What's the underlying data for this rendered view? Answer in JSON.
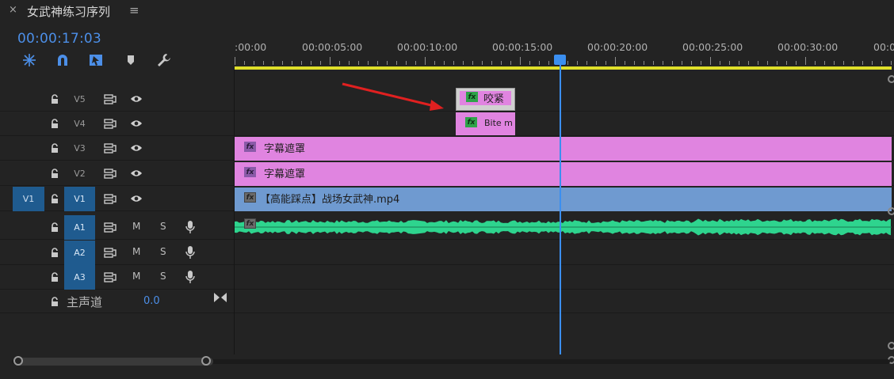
{
  "window": {
    "close_glyph": "×",
    "title": "女武神练习序列",
    "menu_glyph": "≡"
  },
  "header": {
    "timecode": "00:00:17:03",
    "tools": [
      "snap-in-nest-icon",
      "magnet-icon",
      "linked-selection-icon",
      "marker-icon",
      "wrench-icon"
    ]
  },
  "ruler": {
    "labels": [
      ":00:00",
      "00:00:05:00",
      "00:00:10:00",
      "00:00:15:00",
      "00:00:20:00",
      "00:00:25:00",
      "00:00:30:00",
      "00:0"
    ]
  },
  "tracks": {
    "video": [
      {
        "id": "V5",
        "label": "V5",
        "target_on": false
      },
      {
        "id": "V4",
        "label": "V4",
        "target_on": false
      },
      {
        "id": "V3",
        "label": "V3",
        "target_on": false
      },
      {
        "id": "V2",
        "label": "V2",
        "target_on": false
      },
      {
        "id": "V1",
        "label": "V1",
        "target_on": true,
        "source_patch": "V1"
      }
    ],
    "audio": [
      {
        "id": "A1",
        "label": "A1",
        "mute": "M",
        "solo": "S"
      },
      {
        "id": "A2",
        "label": "A2",
        "mute": "M",
        "solo": "S"
      },
      {
        "id": "A3",
        "label": "A3",
        "mute": "M",
        "solo": "S"
      }
    ],
    "master": {
      "label": "主声道",
      "value": "0.0"
    }
  },
  "clips": {
    "v5_title": "咬紧",
    "v4_title": "Bite m",
    "v3_title": "字幕遮罩",
    "v2_title": "字幕遮罩",
    "v1_title": "【高能踩点】战场女武神.mp4",
    "fx_label": "fx"
  },
  "colors": {
    "accent_blue": "#3b8ff0",
    "work_area": "#e0e02a",
    "graphic_clip": "#e084e0",
    "video_clip": "#6f9ad0",
    "audio_clip": "#1f7a5c",
    "waveform": "#2ed48e",
    "annotation_arrow": "#e02020"
  }
}
